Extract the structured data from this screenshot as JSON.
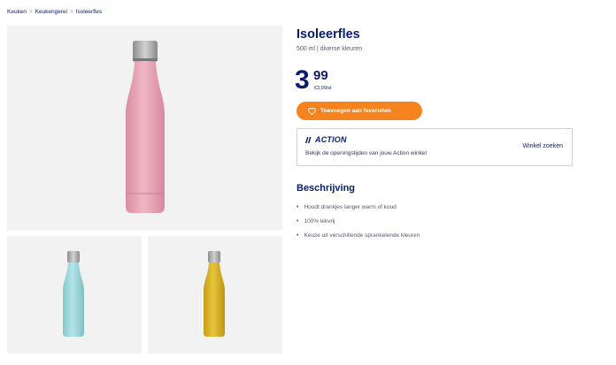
{
  "breadcrumb": {
    "items": [
      "Keuken",
      "Keukengerei",
      "Isoleerfles"
    ],
    "separator": ">"
  },
  "gallery": {
    "main_bottle_color": "#e8a3b5",
    "thumb1_bottle_color": "#9fd8dc",
    "thumb2_bottle_color": "#d6b224",
    "cap_color": "#a9a9a9",
    "background": "#f2f2f2"
  },
  "product": {
    "title": "Isoleerfles",
    "subtitle": "500 ml | diverse kleuren",
    "price_whole": "3",
    "price_cents": "99",
    "price_unit": "€3,99/st"
  },
  "favorite_button": {
    "label": "Toevoegen aan favorieten",
    "icon": "heart-icon",
    "color": "#f5841f"
  },
  "store": {
    "brand": "ACTION",
    "description": "Bekijk de openingstijden van jouw Action winkel",
    "link_label": "Winkel zoeken"
  },
  "description": {
    "heading": "Beschrijving",
    "items": [
      "Houdt drankjes langer warm of koud",
      "100% lekvrij",
      "Keuze uit verschillende sprankelende kleuren"
    ]
  }
}
